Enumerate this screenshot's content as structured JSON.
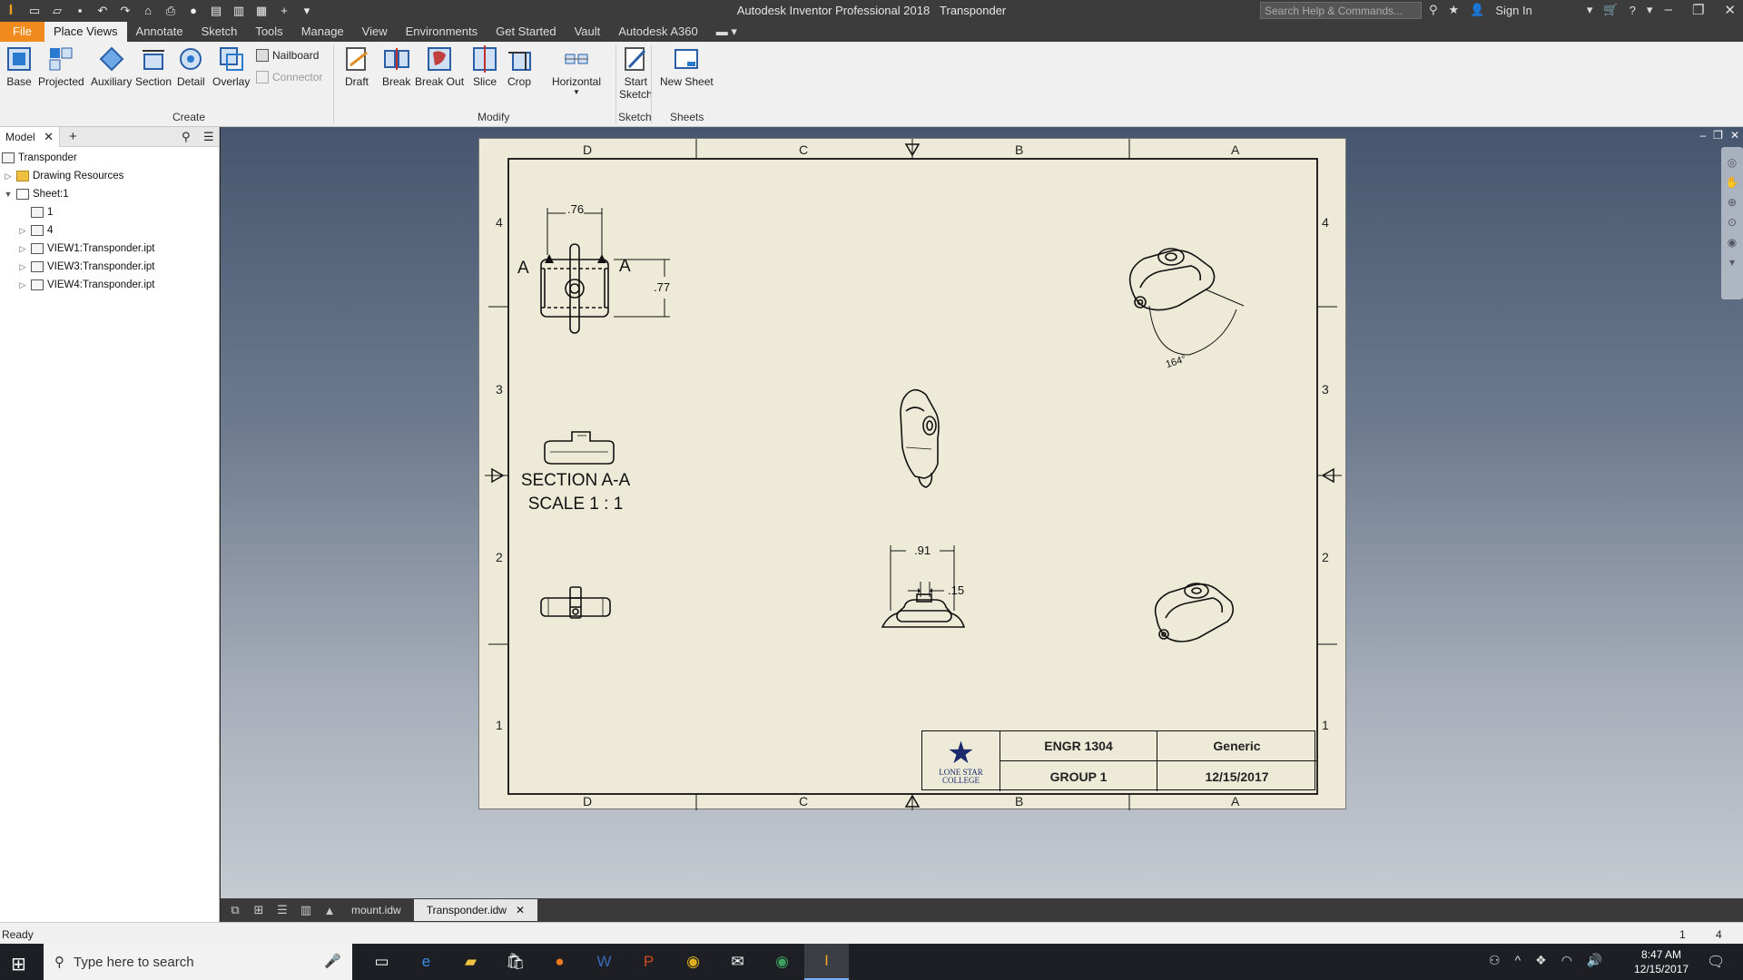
{
  "titlebar": {
    "app_title": "Autodesk Inventor Professional 2018",
    "doc_title": "Transponder",
    "search_placeholder": "Search Help & Commands...",
    "sign_in": "Sign In"
  },
  "tabs": [
    "File",
    "Place Views",
    "Annotate",
    "Sketch",
    "Tools",
    "Manage",
    "View",
    "Environments",
    "Get Started",
    "Vault",
    "Autodesk A360"
  ],
  "active_tab": "Place Views",
  "ribbon": {
    "create": {
      "label": "Create",
      "buttons": [
        "Base",
        "Projected",
        "Auxiliary",
        "Section",
        "Detail",
        "Overlay"
      ],
      "small": [
        "Nailboard",
        "Connector"
      ]
    },
    "modify": {
      "label": "Modify",
      "buttons": [
        "Draft",
        "Break",
        "Break Out",
        "Slice",
        "Crop",
        "Horizontal"
      ]
    },
    "sketch": {
      "label": "Sketch",
      "button_line1": "Start",
      "button_line2": "Sketch"
    },
    "sheets": {
      "label": "Sheets",
      "button": "New Sheet"
    }
  },
  "browser": {
    "tab_label": "Model",
    "nodes": [
      "Transponder",
      "Drawing Resources",
      "Sheet:1",
      "1",
      "4",
      "VIEW1:Transponder.ipt",
      "VIEW3:Transponder.ipt",
      "VIEW4:Transponder.ipt"
    ]
  },
  "sheet": {
    "zones_top": [
      "D",
      "C",
      "B",
      "A"
    ],
    "zones_side": [
      "4",
      "3",
      "2",
      "1"
    ],
    "section_marker": "A",
    "section_label_line1": "SECTION A-A",
    "section_label_line2": "SCALE 1 : 1",
    "dims": {
      "width_top": ".76",
      "height_side": ".77",
      "width_front": ".91",
      "small_front": ".15",
      "angle": "164°"
    },
    "title_block": {
      "course": "ENGR 1304",
      "material": "Generic",
      "group": "GROUP 1",
      "date": "12/15/2017",
      "logo_line1": "LONE STAR",
      "logo_line2": "COLLEGE"
    }
  },
  "doc_tabs": [
    "mount.idw",
    "Transponder.idw"
  ],
  "active_doc": "Transponder.idw",
  "status": {
    "text": "Ready",
    "num1": "1",
    "num2": "4"
  },
  "taskbar": {
    "search_placeholder": "Type here to search",
    "time": "8:47 AM",
    "date": "12/15/2017"
  }
}
